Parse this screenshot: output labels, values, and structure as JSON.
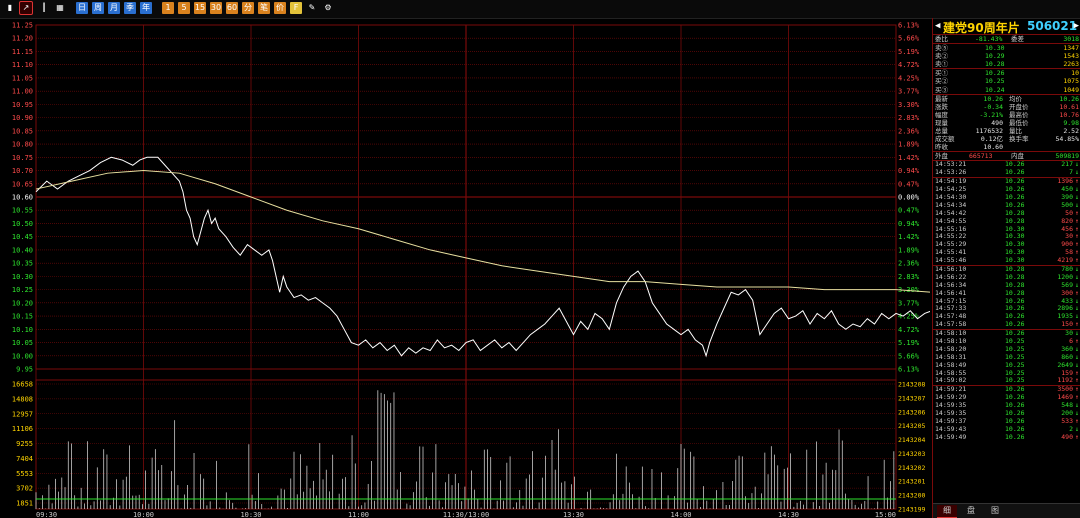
{
  "colors": {
    "up": "#ff4b4b",
    "down": "#2ee52e",
    "grid": "#7a0a0a",
    "price_line": "#ffffff",
    "avg_line": "#e8e0a0",
    "prev_close": "#ffffff"
  },
  "toolbar": {
    "icons": [
      {
        "name": "bar-chart-icon",
        "glyph": "▮"
      },
      {
        "name": "line-chart-icon",
        "glyph": "↗"
      },
      {
        "name": "kline-icon",
        "glyph": "┃"
      },
      {
        "name": "calendar-icon",
        "glyph": "▦"
      }
    ],
    "blue_buttons": [
      "日",
      "周",
      "月",
      "季",
      "年"
    ],
    "orange_buttons": [
      "1",
      "5",
      "15",
      "30",
      "60",
      "分",
      "笔",
      "价",
      "F"
    ],
    "tool_icons": [
      "pencil-icon",
      "gear-icon"
    ]
  },
  "chart_data": {
    "type": "line",
    "prev_close": 10.6,
    "price_ticks": [
      "11.25",
      "11.20",
      "11.15",
      "11.10",
      "11.05",
      "11.00",
      "10.95",
      "10.90",
      "10.85",
      "10.80",
      "10.75",
      "10.70",
      "10.65",
      "10.60",
      "10.55",
      "10.50",
      "10.45",
      "10.40",
      "10.35",
      "10.30",
      "10.25",
      "10.20",
      "10.15",
      "10.10",
      "10.05",
      "10.00",
      "9.95"
    ],
    "pct_ticks": [
      "6.13%",
      "5.66%",
      "5.19%",
      "4.72%",
      "4.25%",
      "3.77%",
      "3.30%",
      "2.83%",
      "2.36%",
      "1.89%",
      "1.42%",
      "0.94%",
      "0.47%",
      "0.00%",
      "0.47%",
      "0.94%",
      "1.42%",
      "1.89%",
      "2.36%",
      "2.83%",
      "3.30%",
      "3.77%",
      "4.25%",
      "4.72%",
      "5.19%",
      "5.66%",
      "6.13%"
    ],
    "time_ticks": [
      "09:30",
      "10:00",
      "10:30",
      "11:00",
      "11:30/13:00",
      "13:30",
      "14:00",
      "14:30",
      "15:00"
    ],
    "vol_ticks_left": [
      "16658",
      "14808",
      "12957",
      "11106",
      "9255",
      "7404",
      "5553",
      "3702",
      "1851"
    ],
    "vol_ticks_right": [
      "2143208",
      "2143207",
      "2143206",
      "2143205",
      "2143204",
      "2143203",
      "2143202",
      "2143201",
      "2143200",
      "2143199"
    ],
    "ylim": [
      9.95,
      11.25
    ],
    "price": [
      [
        0,
        10.62
      ],
      [
        3,
        10.66
      ],
      [
        6,
        10.63
      ],
      [
        9,
        10.66
      ],
      [
        12,
        10.68
      ],
      [
        15,
        10.7
      ],
      [
        18,
        10.73
      ],
      [
        21,
        10.75
      ],
      [
        24,
        10.74
      ],
      [
        27,
        10.72
      ],
      [
        29,
        10.74
      ],
      [
        31,
        10.75
      ],
      [
        34,
        10.75
      ],
      [
        36,
        10.72
      ],
      [
        38,
        10.69
      ],
      [
        40,
        10.66
      ],
      [
        41,
        10.62
      ],
      [
        42,
        10.55
      ],
      [
        43,
        10.52
      ],
      [
        44,
        10.45
      ],
      [
        45,
        10.42
      ],
      [
        46,
        10.47
      ],
      [
        47,
        10.52
      ],
      [
        48,
        10.55
      ],
      [
        49,
        10.5
      ],
      [
        50,
        10.52
      ],
      [
        51,
        10.48
      ],
      [
        53,
        10.45
      ],
      [
        55,
        10.41
      ],
      [
        57,
        10.38
      ],
      [
        59,
        10.42
      ],
      [
        61,
        10.4
      ],
      [
        63,
        10.38
      ],
      [
        65,
        10.4
      ],
      [
        66,
        10.36
      ],
      [
        67,
        10.3
      ],
      [
        68,
        10.24
      ],
      [
        69,
        10.3
      ],
      [
        70,
        10.26
      ],
      [
        72,
        10.22
      ],
      [
        74,
        10.23
      ],
      [
        76,
        10.21
      ],
      [
        78,
        10.22
      ],
      [
        80,
        10.2
      ],
      [
        82,
        10.18
      ],
      [
        84,
        10.15
      ],
      [
        86,
        10.1
      ],
      [
        88,
        10.05
      ],
      [
        90,
        10.04
      ],
      [
        92,
        10.06
      ],
      [
        94,
        10.03
      ],
      [
        96,
        10.05
      ],
      [
        98,
        10.02
      ],
      [
        100,
        10.04
      ],
      [
        102,
        10.0
      ],
      [
        104,
        10.03
      ],
      [
        106,
        10.01
      ],
      [
        108,
        10.03
      ],
      [
        110,
        10.02
      ],
      [
        112,
        10.06
      ],
      [
        114,
        10.03
      ],
      [
        116,
        10.04
      ],
      [
        118,
        10.02
      ],
      [
        120,
        10.05
      ],
      [
        122,
        10.06
      ],
      [
        124,
        10.02
      ],
      [
        126,
        10.04
      ],
      [
        128,
        10.06
      ],
      [
        130,
        10.03
      ],
      [
        132,
        10.05
      ],
      [
        134,
        10.02
      ],
      [
        136,
        10.05
      ],
      [
        138,
        10.08
      ],
      [
        140,
        10.1
      ],
      [
        142,
        10.12
      ],
      [
        144,
        10.15
      ],
      [
        146,
        10.18
      ],
      [
        148,
        10.13
      ],
      [
        150,
        10.08
      ],
      [
        152,
        10.13
      ],
      [
        154,
        10.1
      ],
      [
        156,
        10.16
      ],
      [
        158,
        10.14
      ],
      [
        160,
        10.1
      ],
      [
        162,
        10.2
      ],
      [
        164,
        10.26
      ],
      [
        166,
        10.3
      ],
      [
        168,
        10.32
      ],
      [
        170,
        10.28
      ],
      [
        172,
        10.2
      ],
      [
        174,
        10.16
      ],
      [
        176,
        10.12
      ],
      [
        178,
        10.1
      ],
      [
        180,
        10.08
      ],
      [
        182,
        10.1
      ],
      [
        184,
        10.06
      ],
      [
        186,
        10.04
      ],
      [
        187,
        10.0
      ],
      [
        188,
        10.05
      ],
      [
        190,
        10.12
      ],
      [
        192,
        10.18
      ],
      [
        194,
        10.24
      ],
      [
        196,
        10.23
      ],
      [
        198,
        10.25
      ],
      [
        200,
        10.21
      ],
      [
        202,
        10.08
      ],
      [
        204,
        10.12
      ],
      [
        206,
        10.16
      ],
      [
        208,
        10.18
      ],
      [
        210,
        10.14
      ],
      [
        212,
        10.15
      ],
      [
        214,
        10.17
      ],
      [
        216,
        10.12
      ],
      [
        218,
        10.16
      ],
      [
        220,
        10.14
      ],
      [
        222,
        10.17
      ],
      [
        224,
        10.12
      ],
      [
        226,
        10.1
      ],
      [
        228,
        10.12
      ],
      [
        230,
        10.11
      ],
      [
        232,
        10.14
      ],
      [
        234,
        10.12
      ],
      [
        236,
        10.16
      ],
      [
        238,
        10.14
      ],
      [
        240,
        10.16
      ],
      [
        242,
        10.15
      ],
      [
        244,
        10.17
      ],
      [
        246,
        10.14
      ],
      [
        248,
        10.16
      ],
      [
        250,
        10.17
      ],
      [
        252,
        10.15
      ],
      [
        254,
        10.19
      ],
      [
        256,
        10.21
      ],
      [
        258,
        10.2
      ],
      [
        260,
        10.24
      ],
      [
        262,
        10.27
      ],
      [
        264,
        10.23
      ],
      [
        266,
        10.22
      ],
      [
        268,
        10.25
      ],
      [
        270,
        10.28
      ],
      [
        272,
        10.25
      ],
      [
        274,
        10.24
      ],
      [
        276,
        10.26
      ],
      [
        278,
        10.26
      ]
    ],
    "avg": [
      [
        0,
        10.63
      ],
      [
        10,
        10.66
      ],
      [
        20,
        10.69
      ],
      [
        30,
        10.7
      ],
      [
        40,
        10.69
      ],
      [
        50,
        10.65
      ],
      [
        60,
        10.6
      ],
      [
        70,
        10.55
      ],
      [
        80,
        10.51
      ],
      [
        90,
        10.48
      ],
      [
        100,
        10.44
      ],
      [
        110,
        10.4
      ],
      [
        120,
        10.37
      ],
      [
        130,
        10.34
      ],
      [
        140,
        10.32
      ],
      [
        150,
        10.3
      ],
      [
        160,
        10.28
      ],
      [
        170,
        10.28
      ],
      [
        180,
        10.27
      ],
      [
        190,
        10.26
      ],
      [
        200,
        10.26
      ],
      [
        210,
        10.26
      ],
      [
        220,
        10.25
      ],
      [
        230,
        10.25
      ],
      [
        240,
        10.25
      ],
      [
        250,
        10.24
      ],
      [
        260,
        10.24
      ],
      [
        270,
        10.25
      ],
      [
        278,
        10.25
      ]
    ],
    "grid": true
  },
  "panel": {
    "name": "建党90周年片",
    "code": "506021",
    "weibi": {
      "label": "委比",
      "value": "-81.43%",
      "label2": "委差",
      "value2": "3018"
    },
    "sell": [
      {
        "label": "卖⑤",
        "price": "10.30",
        "vol": "1347"
      },
      {
        "label": "卖②",
        "price": "10.29",
        "vol": "1543"
      },
      {
        "label": "卖①",
        "price": "10.28",
        "vol": "2263"
      }
    ],
    "buy": [
      {
        "label": "买①",
        "price": "10.26",
        "vol": "10"
      },
      {
        "label": "买②",
        "price": "10.25",
        "vol": "1075"
      },
      {
        "label": "买③",
        "price": "10.24",
        "vol": "1049"
      }
    ],
    "quotes": [
      {
        "l1": "最新",
        "v1": "10.26",
        "l2": "均价",
        "v2": "10.26",
        "c1": "dn",
        "c2": "dn"
      },
      {
        "l1": "涨跌",
        "v1": "-0.34",
        "l2": "开盘价",
        "v2": "10.61",
        "c1": "dn",
        "c2": "up"
      },
      {
        "l1": "幅度",
        "v1": "-3.21%",
        "l2": "最高价",
        "v2": "10.76",
        "c1": "dn",
        "c2": "up"
      },
      {
        "l1": "现量",
        "v1": "490",
        "l2": "最低价",
        "v2": "9.98",
        "c1": "w",
        "c2": "dn"
      },
      {
        "l1": "总量",
        "v1": "1176532",
        "l2": "量比",
        "v2": "2.52",
        "c1": "w",
        "c2": "w"
      },
      {
        "l1": "成交额",
        "v1": "0.12亿",
        "l2": "换手率",
        "v2": "54.85%",
        "c1": "w",
        "c2": "w"
      },
      {
        "l1": "昨收",
        "v1": "10.60",
        "l2": "",
        "v2": "",
        "c1": "w",
        "c2": "w"
      }
    ],
    "outer": {
      "label": "外盘",
      "value": "665713",
      "label2": "内盘",
      "value2": "509819"
    },
    "ticks": [
      [
        "14:53:21",
        "10.26",
        "217",
        "dn"
      ],
      [
        "14:53:26",
        "10.26",
        "7",
        "dn"
      ],
      [
        "14:54:19",
        "10.26",
        "1396",
        "up"
      ],
      [
        "14:54:25",
        "10.26",
        "450",
        "dn"
      ],
      [
        "14:54:30",
        "10.26",
        "390",
        "dn"
      ],
      [
        "14:54:34",
        "10.26",
        "500",
        "dn"
      ],
      [
        "14:54:42",
        "10.28",
        "50",
        "up"
      ],
      [
        "14:54:55",
        "10.28",
        "820",
        "up"
      ],
      [
        "14:55:16",
        "10.30",
        "456",
        "up"
      ],
      [
        "14:55:22",
        "10.30",
        "30",
        "up"
      ],
      [
        "14:55:29",
        "10.30",
        "900",
        "up"
      ],
      [
        "14:55:41",
        "10.30",
        "58",
        "up"
      ],
      [
        "14:55:46",
        "10.30",
        "4219",
        "up"
      ],
      [
        "14:56:10",
        "10.28",
        "780",
        "dn"
      ],
      [
        "14:56:22",
        "10.28",
        "1200",
        "dn"
      ],
      [
        "14:56:34",
        "10.28",
        "569",
        "dn"
      ],
      [
        "14:56:41",
        "10.28",
        "300",
        "up"
      ],
      [
        "14:57:15",
        "10.26",
        "433",
        "dn"
      ],
      [
        "14:57:33",
        "10.26",
        "2896",
        "dn"
      ],
      [
        "14:57:48",
        "10.26",
        "1935",
        "dn"
      ],
      [
        "14:57:58",
        "10.26",
        "150",
        "up"
      ],
      [
        "14:58:10",
        "10.26",
        "30",
        "dn"
      ],
      [
        "14:58:10",
        "10.25",
        "6",
        "up"
      ],
      [
        "14:58:20",
        "10.25",
        "360",
        "dn"
      ],
      [
        "14:58:31",
        "10.25",
        "860",
        "dn"
      ],
      [
        "14:58:49",
        "10.25",
        "2649",
        "dn"
      ],
      [
        "14:58:55",
        "10.25",
        "159",
        "up"
      ],
      [
        "14:59:02",
        "10.25",
        "1192",
        "up"
      ],
      [
        "14:59:21",
        "10.26",
        "3500",
        "up"
      ],
      [
        "14:59:29",
        "10.26",
        "1469",
        "up"
      ],
      [
        "14:59:35",
        "10.26",
        "548",
        "dn"
      ],
      [
        "14:59:35",
        "10.26",
        "200",
        "dn"
      ],
      [
        "14:59:37",
        "10.26",
        "533",
        "up"
      ],
      [
        "14:59:43",
        "10.26",
        "2",
        "dn"
      ],
      [
        "14:59:49",
        "10.26",
        "490",
        "up"
      ]
    ],
    "tabs": [
      "细",
      "盘",
      "图"
    ]
  }
}
